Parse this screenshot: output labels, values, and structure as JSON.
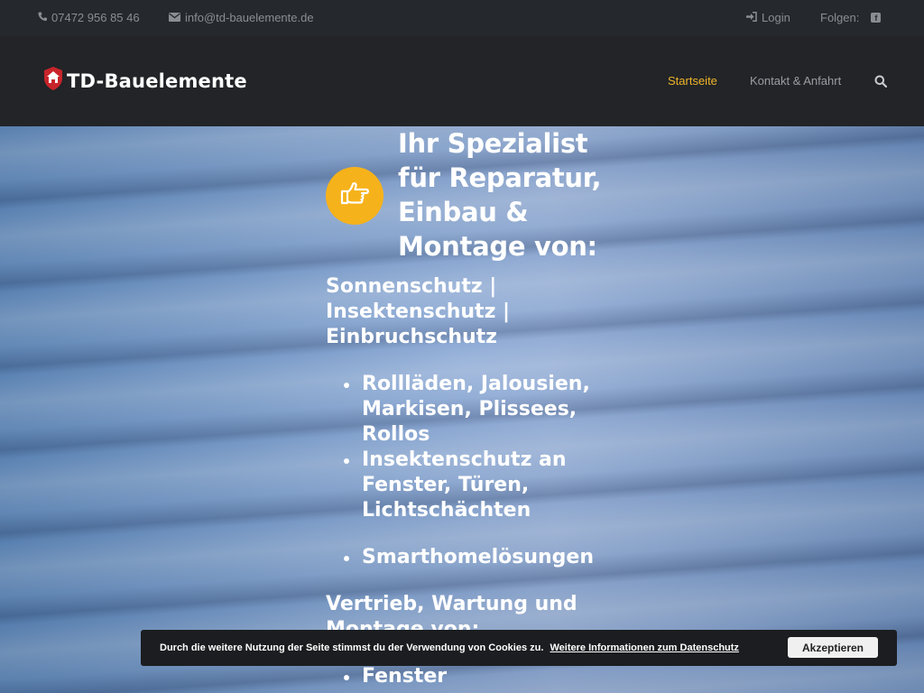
{
  "topbar": {
    "phone": "07472 956 85 46",
    "email": "info@td-bauelemente.de",
    "login": "Login",
    "follow": "Folgen:"
  },
  "header": {
    "logo_text": "TD-Bauelemente",
    "nav": {
      "home": "Startseite",
      "contact": "Kontakt & Anfahrt"
    }
  },
  "hero": {
    "title_lines": [
      "Ihr Spezialist",
      "für Reparatur,",
      "Einbau &",
      "Montage von:"
    ],
    "subtitle_lines": [
      "Sonnenschutz |",
      "Insektenschutz |",
      "Einbruchschutz"
    ],
    "list1": [
      [
        "Rollläden, Jalousien,",
        "Markisen, Plissees,",
        "Rollos"
      ],
      [
        "Insektenschutz an",
        "Fenster, Türen,",
        "Lichtschächten"
      ]
    ],
    "list2": [
      "Smarthomelösungen"
    ],
    "subtitle2_lines": [
      "Vertrieb, Wartung und",
      "Montage von:"
    ],
    "list3": [
      "Fenster"
    ]
  },
  "cookie": {
    "text": "Durch die weitere Nutzung der Seite stimmst du der Verwendung von Cookies zu.",
    "link": "Weitere Informationen zum Datenschutz",
    "accept": "Akzeptieren"
  },
  "colors": {
    "accent": "#f0b429",
    "icon_circle": "#f6b21b",
    "topbar_bg": "#25282c",
    "header_bg": "#222427"
  },
  "icons": {
    "phone": "phone-icon",
    "mail": "envelope-icon",
    "login": "sign-in-icon",
    "facebook": "facebook-icon",
    "search": "search-icon",
    "hero": "hand-pointing-right-icon",
    "logo": "house-shield-icon"
  }
}
